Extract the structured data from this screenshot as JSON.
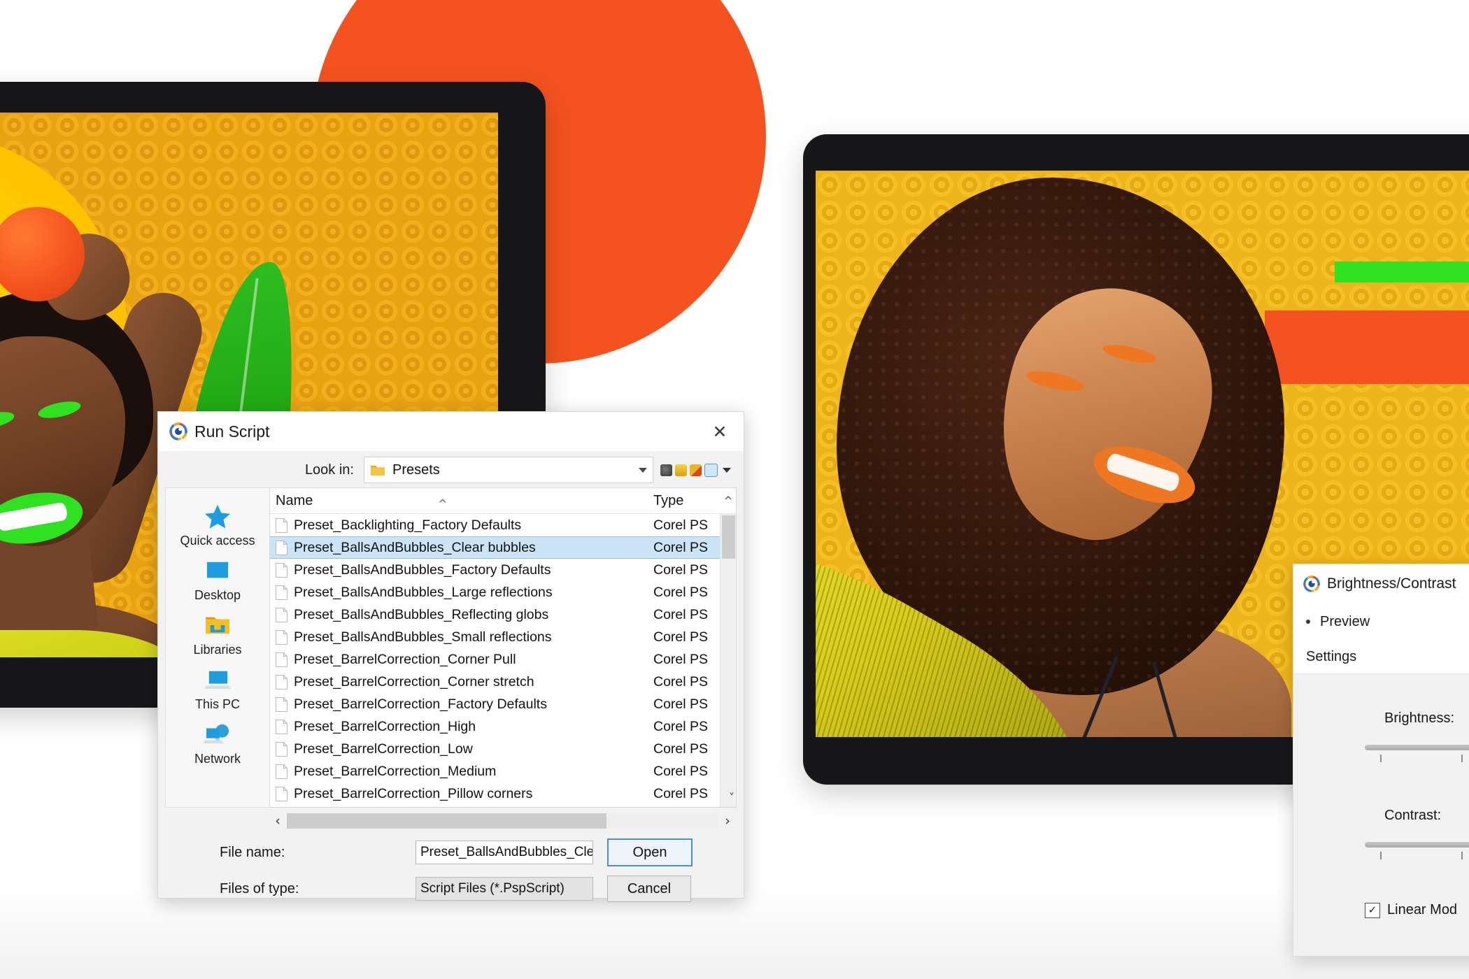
{
  "artwork": {
    "colors": {
      "orange": "#f4521e",
      "yellow": "#ffd400",
      "ochre": "#e8a313",
      "green": "#2fe21f",
      "bezel": "#17171a"
    }
  },
  "run_script_dialog": {
    "title": "Run Script",
    "logo_icon": "paintshop-pro-logo-icon",
    "close_icon": "✕",
    "look_in": {
      "label": "Look in:",
      "value": "Presets",
      "folder_icon": "folder-icon",
      "dropdown_icon": "chevron-down-icon"
    },
    "toolbar_icons": [
      "back-icon",
      "up-one-level-icon",
      "create-new-folder-icon",
      "view-menu-icon",
      "view-dropdown-icon"
    ],
    "places": [
      {
        "label": "Quick access",
        "icon": "star-icon"
      },
      {
        "label": "Desktop",
        "icon": "desktop-icon"
      },
      {
        "label": "Libraries",
        "icon": "libraries-folder-icon"
      },
      {
        "label": "This PC",
        "icon": "this-pc-icon"
      },
      {
        "label": "Network",
        "icon": "network-icon"
      }
    ],
    "columns": {
      "name": "Name",
      "type": "Type",
      "sort_indicator": "^"
    },
    "files": [
      {
        "name": "Preset_Backlighting_Factory Defaults",
        "type": "Corel PS",
        "selected": false
      },
      {
        "name": "Preset_BallsAndBubbles_Clear bubbles",
        "type": "Corel PS",
        "selected": true
      },
      {
        "name": "Preset_BallsAndBubbles_Factory Defaults",
        "type": "Corel PS",
        "selected": false
      },
      {
        "name": "Preset_BallsAndBubbles_Large reflections",
        "type": "Corel PS",
        "selected": false
      },
      {
        "name": "Preset_BallsAndBubbles_Reflecting globs",
        "type": "Corel PS",
        "selected": false
      },
      {
        "name": "Preset_BallsAndBubbles_Small reflections",
        "type": "Corel PS",
        "selected": false
      },
      {
        "name": "Preset_BarrelCorrection_Corner Pull",
        "type": "Corel PS",
        "selected": false
      },
      {
        "name": "Preset_BarrelCorrection_Corner stretch",
        "type": "Corel PS",
        "selected": false
      },
      {
        "name": "Preset_BarrelCorrection_Factory Defaults",
        "type": "Corel PS",
        "selected": false
      },
      {
        "name": "Preset_BarrelCorrection_High",
        "type": "Corel PS",
        "selected": false
      },
      {
        "name": "Preset_BarrelCorrection_Low",
        "type": "Corel PS",
        "selected": false
      },
      {
        "name": "Preset_BarrelCorrection_Medium",
        "type": "Corel PS",
        "selected": false
      },
      {
        "name": "Preset_BarrelCorrection_Pillow corners",
        "type": "Corel PS",
        "selected": false
      }
    ],
    "scroll": {
      "left_arrow": "‹",
      "right_arrow": "›",
      "up_arrow": "^",
      "down_arrow": "˅"
    },
    "file_name": {
      "label": "File name:",
      "value": "Preset_BallsAndBubbles_Clear bu"
    },
    "files_of_type": {
      "label": "Files of type:",
      "value": "Script Files (*.PspScript)"
    },
    "buttons": {
      "open": "Open",
      "cancel": "Cancel"
    }
  },
  "brightness_contrast_panel": {
    "title": "Brightness/Contrast",
    "logo_icon": "paintshop-pro-logo-icon",
    "preview_label": "Preview",
    "settings_label": "Settings",
    "brightness": {
      "label": "Brightness:"
    },
    "contrast": {
      "label": "Contrast:"
    },
    "linear_mode": {
      "label": "Linear Mod",
      "checked": true,
      "check_glyph": "✓"
    }
  }
}
